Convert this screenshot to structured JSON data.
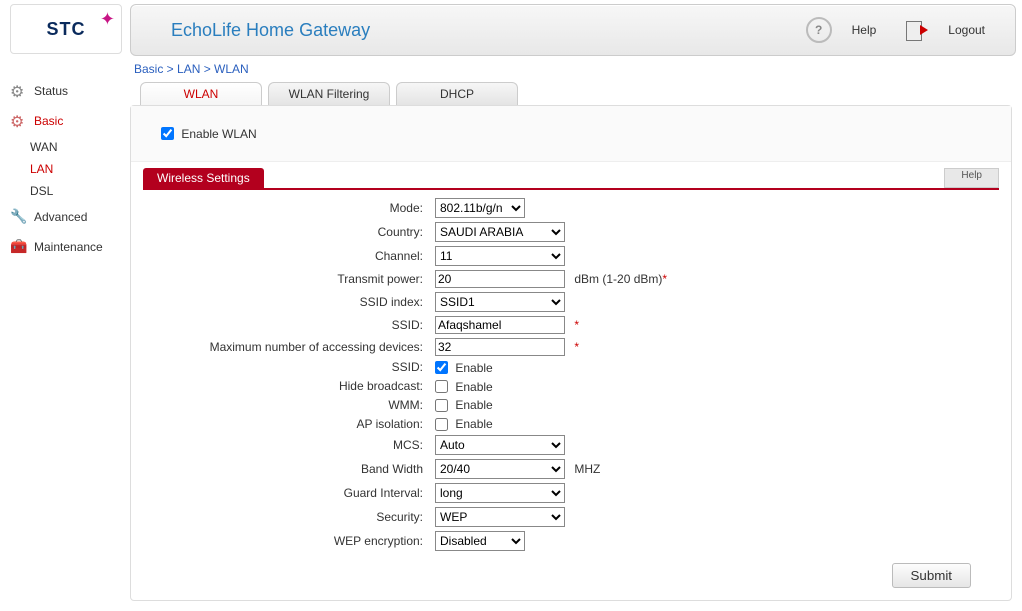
{
  "header": {
    "title": "EchoLife Home Gateway",
    "help_label": "Help",
    "logout_label": "Logout",
    "logo_text": "STC"
  },
  "breadcrumb": "Basic > LAN > WLAN",
  "sidebar": {
    "status": "Status",
    "basic": "Basic",
    "wan": "WAN",
    "lan": "LAN",
    "dsl": "DSL",
    "advanced": "Advanced",
    "maintenance": "Maintenance"
  },
  "tabs": {
    "wlan": "WLAN",
    "filtering": "WLAN Filtering",
    "dhcp": "DHCP"
  },
  "enable_wlan_label": "Enable WLAN",
  "section": {
    "title": "Wireless Settings",
    "help": "Help"
  },
  "labels": {
    "mode": "Mode:",
    "country": "Country:",
    "channel": "Channel:",
    "tx_power": "Transmit power:",
    "ssid_index": "SSID index:",
    "ssid": "SSID:",
    "max_devices": "Maximum number of accessing devices:",
    "ssid_enable": "SSID:",
    "hide_broadcast": "Hide broadcast:",
    "wmm": "WMM:",
    "ap_isolation": "AP isolation:",
    "mcs": "MCS:",
    "band_width": "Band Width",
    "guard_interval": "Guard Interval:",
    "security": "Security:",
    "wep_encryption": "WEP encryption:",
    "enable": "Enable"
  },
  "values": {
    "mode": "802.11b/g/n",
    "country": "SAUDI ARABIA",
    "channel": "11",
    "tx_power": "20",
    "tx_power_suffix": "dBm (1-20 dBm)",
    "ssid_index": "SSID1",
    "ssid": "Afaqshamel",
    "max_devices": "32",
    "ssid_enabled": true,
    "hide_broadcast": false,
    "wmm": false,
    "ap_isolation": false,
    "mcs": "Auto",
    "band_width": "20/40",
    "band_width_suffix": "MHZ",
    "guard_interval": "long",
    "security": "WEP",
    "wep_encryption": "Disabled"
  },
  "submit_label": "Submit",
  "asterisk": "*"
}
